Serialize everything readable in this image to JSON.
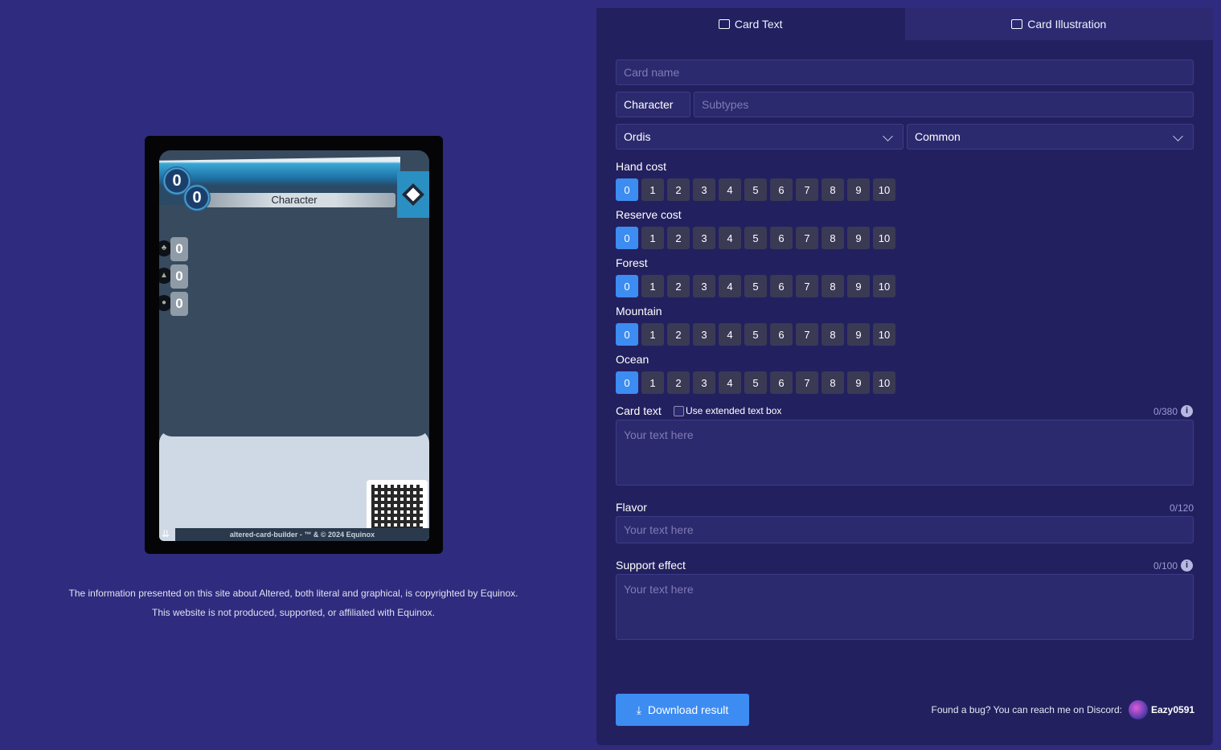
{
  "card_preview": {
    "hand_cost": "0",
    "reserve_cost": "0",
    "type": "Character",
    "forest": "0",
    "mountain": "0",
    "ocean": "0",
    "footer": "altered-card-builder - ™ & © 2024 Equinox"
  },
  "disclaimer": {
    "line1": "The information presented on this site about Altered, both literal and graphical, is copyrighted by Equinox.",
    "line2": "This website is not produced, supported, or affiliated with Equinox."
  },
  "tabs": {
    "text": "Card Text",
    "illustration": "Card Illustration"
  },
  "form": {
    "card_name_placeholder": "Card name",
    "type_value": "Character",
    "subtypes_placeholder": "Subtypes",
    "faction_value": "Ordis",
    "rarity_value": "Common",
    "hand_cost_label": "Hand cost",
    "reserve_cost_label": "Reserve cost",
    "forest_label": "Forest",
    "mountain_label": "Mountain",
    "ocean_label": "Ocean",
    "numbers": [
      "0",
      "1",
      "2",
      "3",
      "4",
      "5",
      "6",
      "7",
      "8",
      "9",
      "10"
    ],
    "selected": {
      "hand": 0,
      "reserve": 0,
      "forest": 0,
      "mountain": 0,
      "ocean": 0
    },
    "card_text_label": "Card text",
    "extended_label": "Use extended text box",
    "card_text_counter": "0/380",
    "card_text_placeholder": "Your text here",
    "flavor_label": "Flavor",
    "flavor_counter": "0/120",
    "flavor_placeholder": "Your text here",
    "support_label": "Support effect",
    "support_counter": "0/100",
    "support_placeholder": "Your text here"
  },
  "footer": {
    "download_label": "Download result",
    "bug_text": "Found a bug? You can reach me on Discord:",
    "username": "Eazy0591"
  },
  "colors": {
    "page_bg": "#2f2b7e",
    "panel_bg": "#23205f",
    "accent": "#3d8cf2"
  }
}
